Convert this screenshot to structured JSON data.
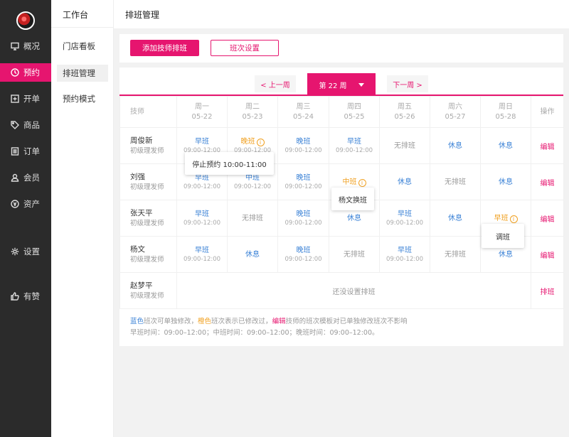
{
  "nav": {
    "items": [
      {
        "label": "概况",
        "icon": "monitor-icon"
      },
      {
        "label": "预约",
        "icon": "clock-icon"
      },
      {
        "label": "开单",
        "icon": "plus-square-icon"
      },
      {
        "label": "商品",
        "icon": "tag-icon"
      },
      {
        "label": "订单",
        "icon": "list-icon"
      },
      {
        "label": "会员",
        "icon": "user-icon"
      },
      {
        "label": "资产",
        "icon": "asset-icon"
      },
      {
        "label": "设置",
        "icon": "gear-icon"
      },
      {
        "label": "有赞",
        "icon": "thumbs-up-icon"
      }
    ]
  },
  "subnav": {
    "title": "工作台",
    "items": [
      {
        "label": "门店看板"
      },
      {
        "label": "排班管理"
      },
      {
        "label": "预约模式"
      }
    ]
  },
  "header": {
    "title": "排班管理"
  },
  "toolbar": {
    "add_label": "添加技师排班",
    "shift_settings_label": "班次设置"
  },
  "week_nav": {
    "prev": "< 上一周",
    "current": "第 22 周",
    "next": "下一周 >"
  },
  "table": {
    "tech_header": "技师",
    "action_header": "操作",
    "days": [
      {
        "name": "周一",
        "date": "05-22"
      },
      {
        "name": "周二",
        "date": "05-23"
      },
      {
        "name": "周三",
        "date": "05-24"
      },
      {
        "name": "周四",
        "date": "05-25"
      },
      {
        "name": "周五",
        "date": "05-26"
      },
      {
        "name": "周六",
        "date": "05-27"
      },
      {
        "name": "周日",
        "date": "05-28"
      }
    ],
    "rows": [
      {
        "name": "周俊新",
        "role": "初级理发师",
        "action": "编辑",
        "cells": [
          {
            "s": "早班",
            "t": "09:00-12:00",
            "c": "blue"
          },
          {
            "s": "晚班",
            "t": "09:00-12:00",
            "c": "orange",
            "w": true
          },
          {
            "s": "晚班",
            "t": "09:00-12:00",
            "c": "blue"
          },
          {
            "s": "早班",
            "t": "09:00-12:00",
            "c": "blue"
          },
          {
            "s": "无排班",
            "c": "gray"
          },
          {
            "s": "休息",
            "c": "blue"
          },
          {
            "s": "休息",
            "c": "blue"
          }
        ]
      },
      {
        "name": "刘强",
        "role": "初级理发师",
        "action": "编辑",
        "cells": [
          {
            "s": "早班",
            "t": "09:00-12:00",
            "c": "blue"
          },
          {
            "s": "中班",
            "t": "09:00-12:00",
            "c": "blue"
          },
          {
            "s": "晚班",
            "t": "09:00-12:00",
            "c": "blue"
          },
          {
            "s": "中班",
            "c": "orange",
            "w": true
          },
          {
            "s": "休息",
            "c": "blue"
          },
          {
            "s": "无排班",
            "c": "gray"
          },
          {
            "s": "休息",
            "c": "blue"
          }
        ]
      },
      {
        "name": "张天平",
        "role": "初级理发师",
        "action": "编辑",
        "cells": [
          {
            "s": "早班",
            "t": "09:00-12:00",
            "c": "blue"
          },
          {
            "s": "无排班",
            "c": "gray"
          },
          {
            "s": "晚班",
            "t": "09:00-12:00",
            "c": "blue"
          },
          {
            "s": "休息",
            "c": "blue"
          },
          {
            "s": "早班",
            "t": "09:00-12:00",
            "c": "blue"
          },
          {
            "s": "休息",
            "c": "blue"
          },
          {
            "s": "早班",
            "c": "orange",
            "w": true
          }
        ]
      },
      {
        "name": "杨文",
        "role": "初级理发师",
        "action": "编辑",
        "cells": [
          {
            "s": "早班",
            "t": "09:00-12:00",
            "c": "blue"
          },
          {
            "s": "休息",
            "c": "blue"
          },
          {
            "s": "晚班",
            "t": "09:00-12:00",
            "c": "blue"
          },
          {
            "s": "无排班",
            "c": "gray"
          },
          {
            "s": "早班",
            "t": "09:00-12:00",
            "c": "blue"
          },
          {
            "s": "无排班",
            "c": "gray"
          },
          {
            "s": "休息",
            "c": "blue"
          }
        ]
      }
    ],
    "empty_row": {
      "name": "赵梦平",
      "role": "初级理发师",
      "message": "还没设置排班",
      "action": "排班"
    }
  },
  "legend": {
    "blue_word": "蓝色",
    "blue_text": "班次可单独修改，",
    "orange_word": "橙色",
    "orange_text": "班次表示已修改过，",
    "edit_word": "编辑",
    "edit_text": "技师的班次模板对已单独修改班次不影响",
    "times": "早班时间：09:00–12:00；中班时间：09:00–12:00；晚班时间：09:00–12:00。"
  },
  "popovers": {
    "stop": "停止预约 10:00-11:00",
    "swap": "杨文换班",
    "adjust": "调班"
  },
  "colors": {
    "accent": "#e6156f",
    "blue": "#3b82d6",
    "orange": "#f0a020",
    "sidebar": "#2b2b2b"
  }
}
